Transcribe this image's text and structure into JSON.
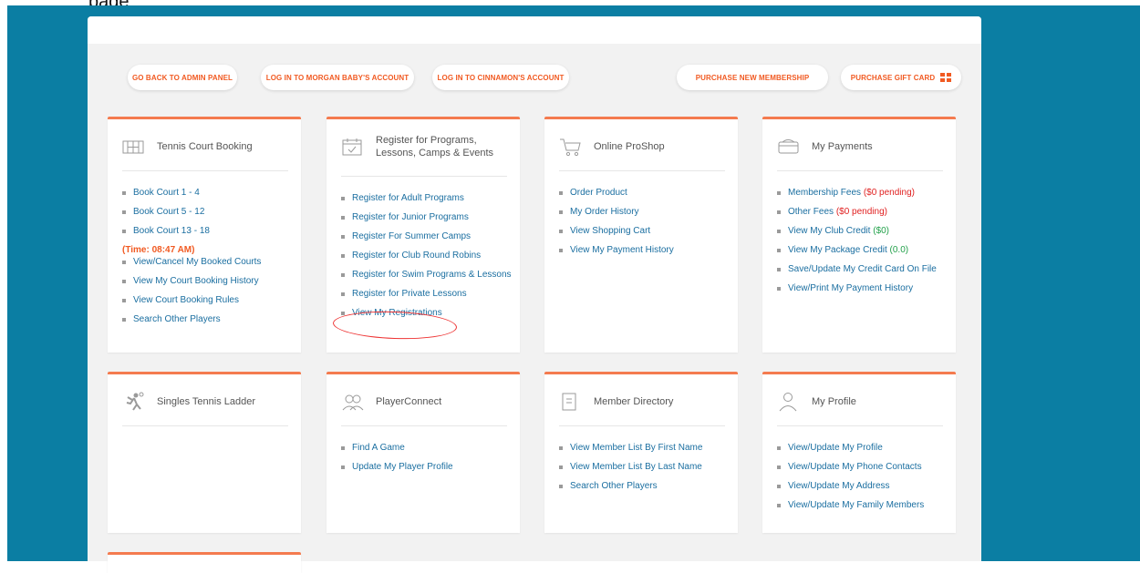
{
  "page_heading": "page",
  "top_buttons": {
    "admin": "GO BACK TO ADMIN PANEL",
    "morgan": "LOG IN TO MORGAN BABY'S ACCOUNT",
    "cinnamon": "LOG IN TO CINNAMON'S ACCOUNT",
    "membership": "PURCHASE NEW MEMBERSHIP",
    "gift": "PURCHASE GIFT CARD"
  },
  "colors": {
    "accent": "#f15a22",
    "link": "#1a6ea0",
    "frame": "#0b7ea3",
    "pending": "#e02020",
    "credit": "#22a14a"
  },
  "cards": {
    "tennis": {
      "title": "Tennis Court Booking",
      "icon": "court-icon",
      "items": [
        "Book Court 1 - 4",
        "Book Court 5 - 12",
        "Book Court 13 - 18"
      ],
      "time": "(Time: 08:47 AM)",
      "items2": [
        "View/Cancel My Booked Courts",
        "View My Court Booking History",
        "View Court Booking Rules",
        "Search Other Players"
      ]
    },
    "register": {
      "title": "Register for Programs, Lessons, Camps & Events",
      "icon": "calendar-icon",
      "items": [
        "Register for Adult Programs",
        "Register for Junior Programs",
        "Register For Summer Camps",
        "Register for Club Round Robins",
        "Register for Swim Programs & Lessons",
        "Register for Private Lessons",
        "View My Registrations"
      ]
    },
    "proshop": {
      "title": "Online ProShop",
      "icon": "cart-icon",
      "items": [
        "Order Product",
        "My Order History",
        "View Shopping Cart",
        "View My Payment History"
      ]
    },
    "payments": {
      "title": "My Payments",
      "icon": "payment-icon",
      "membership_fees": "Membership Fees",
      "membership_pending": "($0 pending)",
      "other_fees": "Other Fees",
      "other_pending": "($0 pending)",
      "club_credit": "View My Club Credit",
      "club_credit_value": "($0)",
      "package_credit": "View My Package Credit",
      "package_credit_value": "(0.0)",
      "card_on_file": "Save/Update My Credit Card On File",
      "payment_history": "View/Print My Payment History"
    },
    "ladder": {
      "title": "Singles Tennis Ladder",
      "icon": "tennis-player-icon"
    },
    "playerconnect": {
      "title": "PlayerConnect",
      "icon": "people-icon",
      "items": [
        "Find A Game",
        "Update My Player Profile"
      ]
    },
    "directory": {
      "title": "Member Directory",
      "icon": "directory-icon",
      "items": [
        "View Member List By First Name",
        "View Member List By Last Name",
        "Search Other Players"
      ]
    },
    "profile": {
      "title": "My Profile",
      "icon": "user-icon",
      "items": [
        "View/Update My Profile",
        "View/Update My Phone Contacts",
        "View/Update My Address",
        "View/Update My Family Members"
      ]
    }
  }
}
